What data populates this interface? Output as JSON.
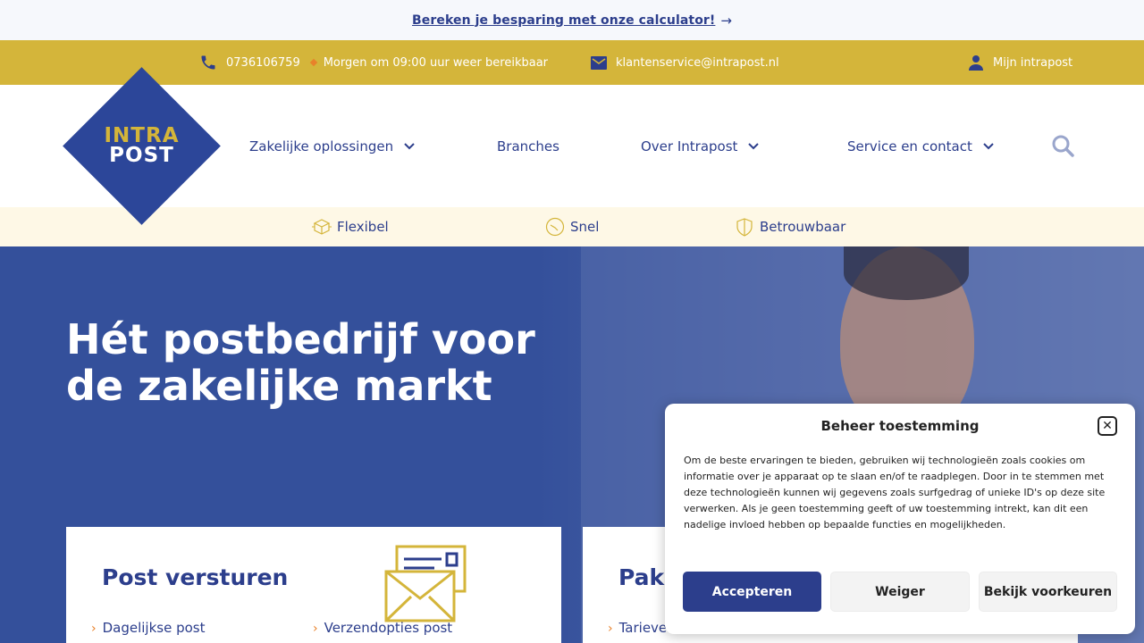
{
  "topbar": {
    "link_text": "Bereken je besparing met onze calculator!",
    "arrow": "→"
  },
  "contact": {
    "phone": "0736106759",
    "availability": "Morgen om 09:00 uur weer bereikbaar",
    "email": "klantenservice@intrapost.nl",
    "account": "Mijn intrapost"
  },
  "logo": {
    "line1": "INTRA",
    "line2": "POST"
  },
  "nav": {
    "items": [
      {
        "label": "Zakelijke oplossingen"
      },
      {
        "label": "Branches"
      },
      {
        "label": "Over Intrapost"
      },
      {
        "label": "Service en contact"
      }
    ]
  },
  "usps": [
    {
      "label": "Flexibel",
      "icon": "box-icon"
    },
    {
      "label": "Snel",
      "icon": "clock-icon"
    },
    {
      "label": "Betrouwbaar",
      "icon": "shield-icon"
    }
  ],
  "hero": {
    "title": "Hét postbedrijf voor de zakelijke markt"
  },
  "cards": [
    {
      "title": "Post versturen",
      "links": [
        "Dagelijkse post",
        "Verzendopties post"
      ]
    },
    {
      "title": "Pakk",
      "links": [
        "Tarieve"
      ]
    }
  ],
  "consent": {
    "title": "Beheer toestemming",
    "body": "Om de beste ervaringen te bieden, gebruiken wij technologieën zoals cookies om informatie over je apparaat op te slaan en/of te raadplegen. Door in te stemmen met deze technologieën kunnen wij gegevens zoals surfgedrag of unieke ID's op deze site verwerken. Als je geen toestemming geeft of uw toestemming intrekt, kan dit een nadelige invloed hebben op bepaalde functies en mogelijkheden.",
    "accept": "Accepteren",
    "deny": "Weiger",
    "preferences": "Bekijk voorkeuren"
  },
  "colors": {
    "primary": "#2c3e8c",
    "gold": "#d4b53a",
    "accent": "#e8812a",
    "usp_bg": "#fef8e6"
  }
}
